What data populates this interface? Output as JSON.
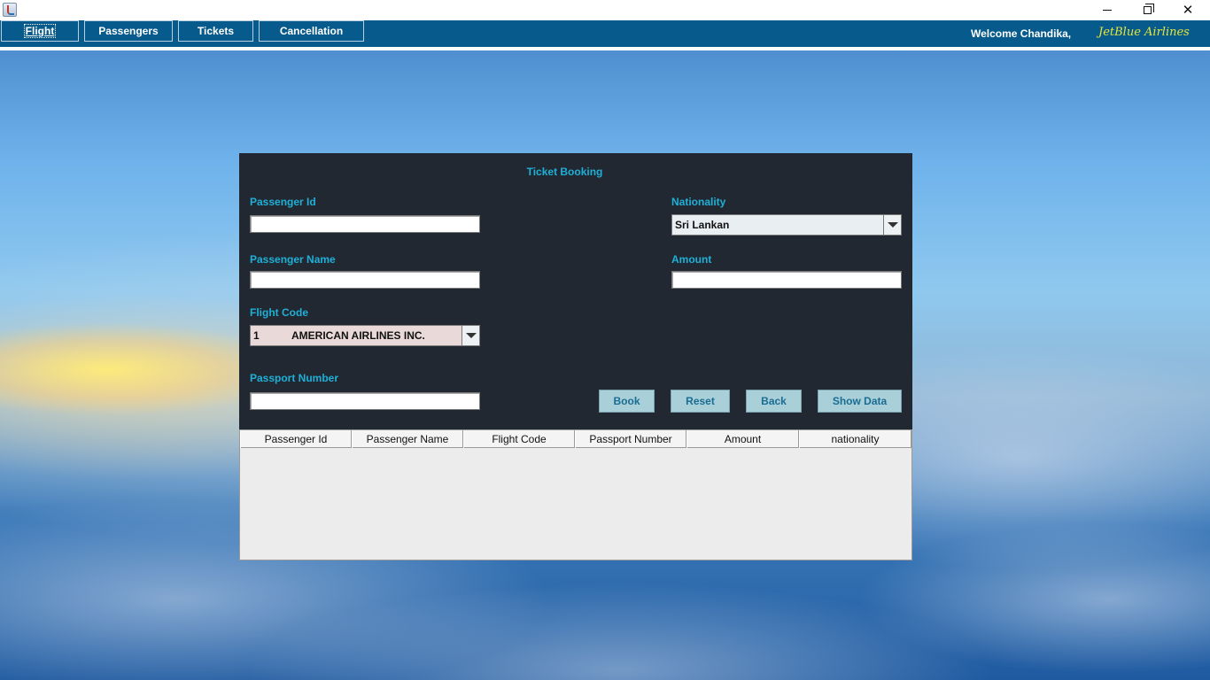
{
  "window": {
    "minimize_glyph": "",
    "close_glyph": "✕"
  },
  "menu": {
    "items": [
      {
        "label": "Flight",
        "active": true
      },
      {
        "label": "Passengers"
      },
      {
        "label": "Tickets"
      },
      {
        "label": "Cancellation"
      }
    ],
    "welcome": "Welcome Chandika,",
    "brand": "JetBlue Airlines"
  },
  "form": {
    "title": "Ticket Booking",
    "passenger_id_label": "Passenger Id",
    "passenger_id_value": "",
    "passenger_name_label": "Passenger Name",
    "passenger_name_value": "",
    "flight_code_label": "Flight Code",
    "flight_code_selected_num": "1",
    "flight_code_selected_name": "AMERICAN AIRLINES INC.",
    "passport_label": "Passport Number",
    "passport_value": "",
    "nationality_label": "Nationality",
    "nationality_selected": "Sri Lankan",
    "amount_label": "Amount",
    "amount_value": ""
  },
  "buttons": {
    "book": "Book",
    "reset": "Reset",
    "back": "Back",
    "show": "Show Data"
  },
  "table": {
    "columns": [
      "Passenger Id",
      "Passenger Name",
      "Flight Code",
      "Passport Number",
      "Amount",
      "nationality"
    ],
    "rows": []
  },
  "colors": {
    "menubar": "#075a8c",
    "panel": "#222831",
    "label": "#1fb0d8",
    "button": "#a9cfd8",
    "brand": "#e6e63a"
  }
}
